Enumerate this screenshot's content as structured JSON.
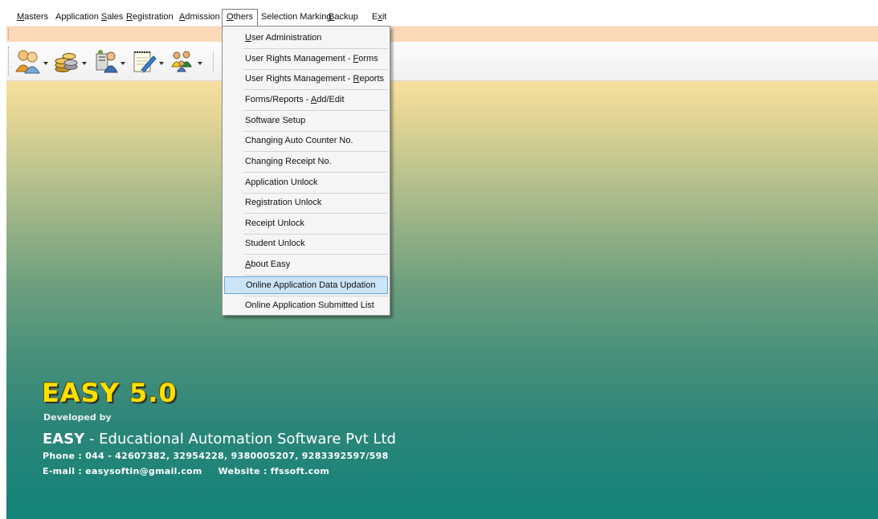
{
  "menubar": {
    "items": [
      {
        "pre": "",
        "key": "M",
        "post": "asters"
      },
      {
        "pre": "Application ",
        "key": "S",
        "post": "ales"
      },
      {
        "pre": "",
        "key": "R",
        "post": "egistration"
      },
      {
        "pre": "",
        "key": "A",
        "post": "dmission"
      },
      {
        "pre": "",
        "key": "O",
        "post": "thers"
      },
      {
        "pre": "Selection Marking",
        "key": "",
        "post": ""
      },
      {
        "pre": "",
        "key": "B",
        "post": "ackup"
      },
      {
        "pre": "E",
        "key": "x",
        "post": "it"
      }
    ]
  },
  "toolbar": {
    "icons": [
      "users-group-icon",
      "coins-icon",
      "people-clipboard-icon",
      "notepad-pencil-icon",
      "family-icon"
    ]
  },
  "dropdown": {
    "items": [
      {
        "pre": "",
        "key": "U",
        "post": "ser Administration"
      },
      {
        "pre": "User Rights Management - ",
        "key": "F",
        "post": "orms"
      },
      {
        "pre": "User Rights Management - ",
        "key": "R",
        "post": "eports"
      },
      {
        "pre": "Forms/Reports - ",
        "key": "A",
        "post": "dd/Edit"
      },
      {
        "pre": "Software Setup",
        "key": "",
        "post": ""
      },
      {
        "pre": "Changing Auto Counter No.",
        "key": "",
        "post": ""
      },
      {
        "pre": "Changing Receipt No.",
        "key": "",
        "post": ""
      },
      {
        "pre": "Application Unlock",
        "key": "",
        "post": ""
      },
      {
        "pre": "Registration Unlock",
        "key": "",
        "post": ""
      },
      {
        "pre": "Receipt Unlock",
        "key": "",
        "post": ""
      },
      {
        "pre": "Student Unlock",
        "key": "",
        "post": ""
      },
      {
        "pre": "",
        "key": "A",
        "post": "bout Easy"
      },
      {
        "pre": "Online Application Data Updation",
        "key": "",
        "post": ""
      },
      {
        "pre": "Online Application Submitted List",
        "key": "",
        "post": ""
      }
    ],
    "highlighted_index": 12
  },
  "brand": {
    "title": "EASY 5.0",
    "developed_by": "Developed by",
    "company_bold": "EASY",
    "company_rest": " - Educational Automation Software Pvt Ltd",
    "phone": "Phone : 044 - 42607382, 32954228, 9380005207, 9283392597/598",
    "email": "E-mail : easysoftin@gmail.com",
    "website": "Website : ffssoft.com"
  },
  "colors": {
    "peach_bar": "#fcd9b6",
    "brand_title": "#ffe000",
    "highlight": "#cce4f7",
    "desktop_top": "#f8e0a0",
    "desktop_bottom": "#138479"
  }
}
